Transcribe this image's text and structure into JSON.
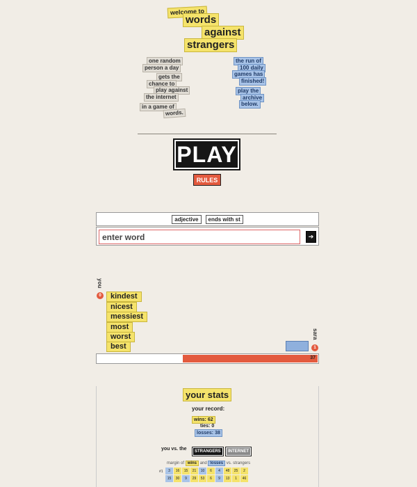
{
  "header": {
    "welcome": "welcome to",
    "title_line1": "words",
    "title_line2": "against",
    "title_line3": "strangers"
  },
  "intro": {
    "left": [
      "one random",
      "person a day",
      "gets the",
      "chance to",
      "play against",
      "the internet",
      "in a game of",
      "words."
    ],
    "right": [
      "the run of",
      "100 daily",
      "games has",
      "finished!",
      "play the",
      "archive",
      "below."
    ]
  },
  "actions": {
    "play": "PLAY",
    "rules": "RULES"
  },
  "prompt": {
    "part_of_speech": "adjective",
    "ends_with": "ends with st"
  },
  "input": {
    "placeholder": "enter word",
    "submit_icon": "arrow-right-icon"
  },
  "board": {
    "you_label": "you",
    "you_score": "0",
    "words": [
      "kindest",
      "nicest",
      "messiest",
      "most",
      "worst",
      "best"
    ],
    "opponent_label": "sara",
    "opponent_score": "1",
    "total": "37"
  },
  "stats": {
    "title": "your stats",
    "record_label": "your record:",
    "wins": "wins: 62",
    "ties": "ties: 0",
    "losses": "losses: 38",
    "vs_label": "you vs. the",
    "toggle_strangers": "STRANGERS",
    "toggle_internet": "INTERNET",
    "margin_pre": "margin of",
    "margin_wins": "wins",
    "margin_and": "and",
    "margin_losses": "losses",
    "margin_post": "vs. strangers",
    "row_label": "#1",
    "grid": [
      [
        "3",
        "16",
        "15",
        "21",
        "10",
        "6",
        "4",
        "48",
        "25",
        "2"
      ],
      [
        "15",
        "30",
        "9",
        "29",
        "53",
        "6",
        "9",
        "13",
        "1",
        "46"
      ]
    ],
    "grid_kinds": [
      [
        "l",
        "w",
        "w",
        "w",
        "l",
        "w",
        "l",
        "w",
        "w",
        "w"
      ],
      [
        "l",
        "w",
        "l",
        "w",
        "w",
        "w",
        "l",
        "w",
        "w",
        "w"
      ]
    ]
  },
  "colors": {
    "yellow": "#f5e36b",
    "blue": "#a9c4e8",
    "red": "#e35a3e",
    "dark": "#161616",
    "background": "#f1ede6"
  }
}
